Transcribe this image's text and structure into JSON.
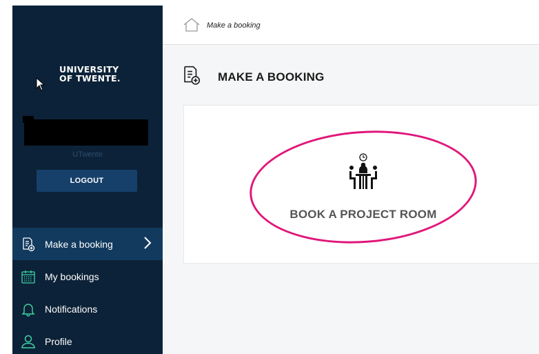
{
  "sidebar": {
    "logo_line1": "UNIVERSITY",
    "logo_line2": "OF TWENTE.",
    "org": "UTwente",
    "logout_label": "LOGOUT",
    "items": [
      {
        "label": "Make a booking",
        "icon": "booking-add-icon",
        "active": true
      },
      {
        "label": "My bookings",
        "icon": "calendar-icon"
      },
      {
        "label": "Notifications",
        "icon": "bell-icon"
      },
      {
        "label": "Profile",
        "icon": "user-icon"
      }
    ]
  },
  "header": {
    "breadcrumb": "Make a booking",
    "breadcrumb_icon": "home-icon"
  },
  "main": {
    "page_title": "MAKE A BOOKING",
    "page_icon": "booking-add-icon",
    "option_label": "BOOK A PROJECT ROOM",
    "option_icon": "meeting-room-icon"
  },
  "colors": {
    "sidebar_bg": "#0c2238",
    "active_bg": "#123a5e",
    "accent_green": "#3fd4a5",
    "highlight": "#e0167a"
  }
}
